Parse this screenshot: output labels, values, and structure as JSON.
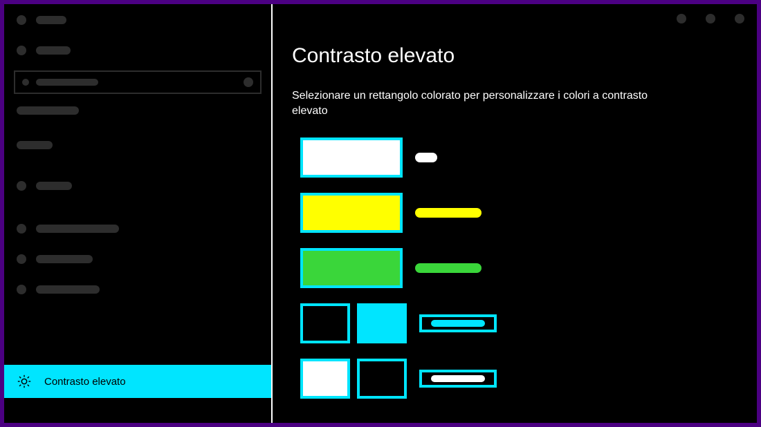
{
  "sidebar": {
    "active_label": "Contrasto elevato"
  },
  "main": {
    "title": "Contrasto elevato",
    "description": "Selezionare un rettangolo colorato per personalizzare i colori a contrasto elevato"
  },
  "swatches": [
    {
      "fill": "#ffffff",
      "label_color": "#ffffff",
      "label_style": "shortpill"
    },
    {
      "fill": "#ffff00",
      "label_color": "#ffff00",
      "label_style": "midpill"
    },
    {
      "fill": "#3ad63a",
      "label_color": "#3ad63a",
      "label_style": "midpill"
    },
    {
      "fill_a": "#000000",
      "fill_b": "#00e5ff",
      "label_bg": "#000000",
      "label_pill": "#00e5ff",
      "label_style": "box",
      "pair": true
    },
    {
      "fill_a": "#ffffff",
      "fill_b": "#000000",
      "label_bg": "#000000",
      "label_pill": "#ffffff",
      "label_style": "box",
      "pair": true
    }
  ],
  "colors": {
    "accent": "#00e5ff",
    "frame": "#4b0082"
  }
}
